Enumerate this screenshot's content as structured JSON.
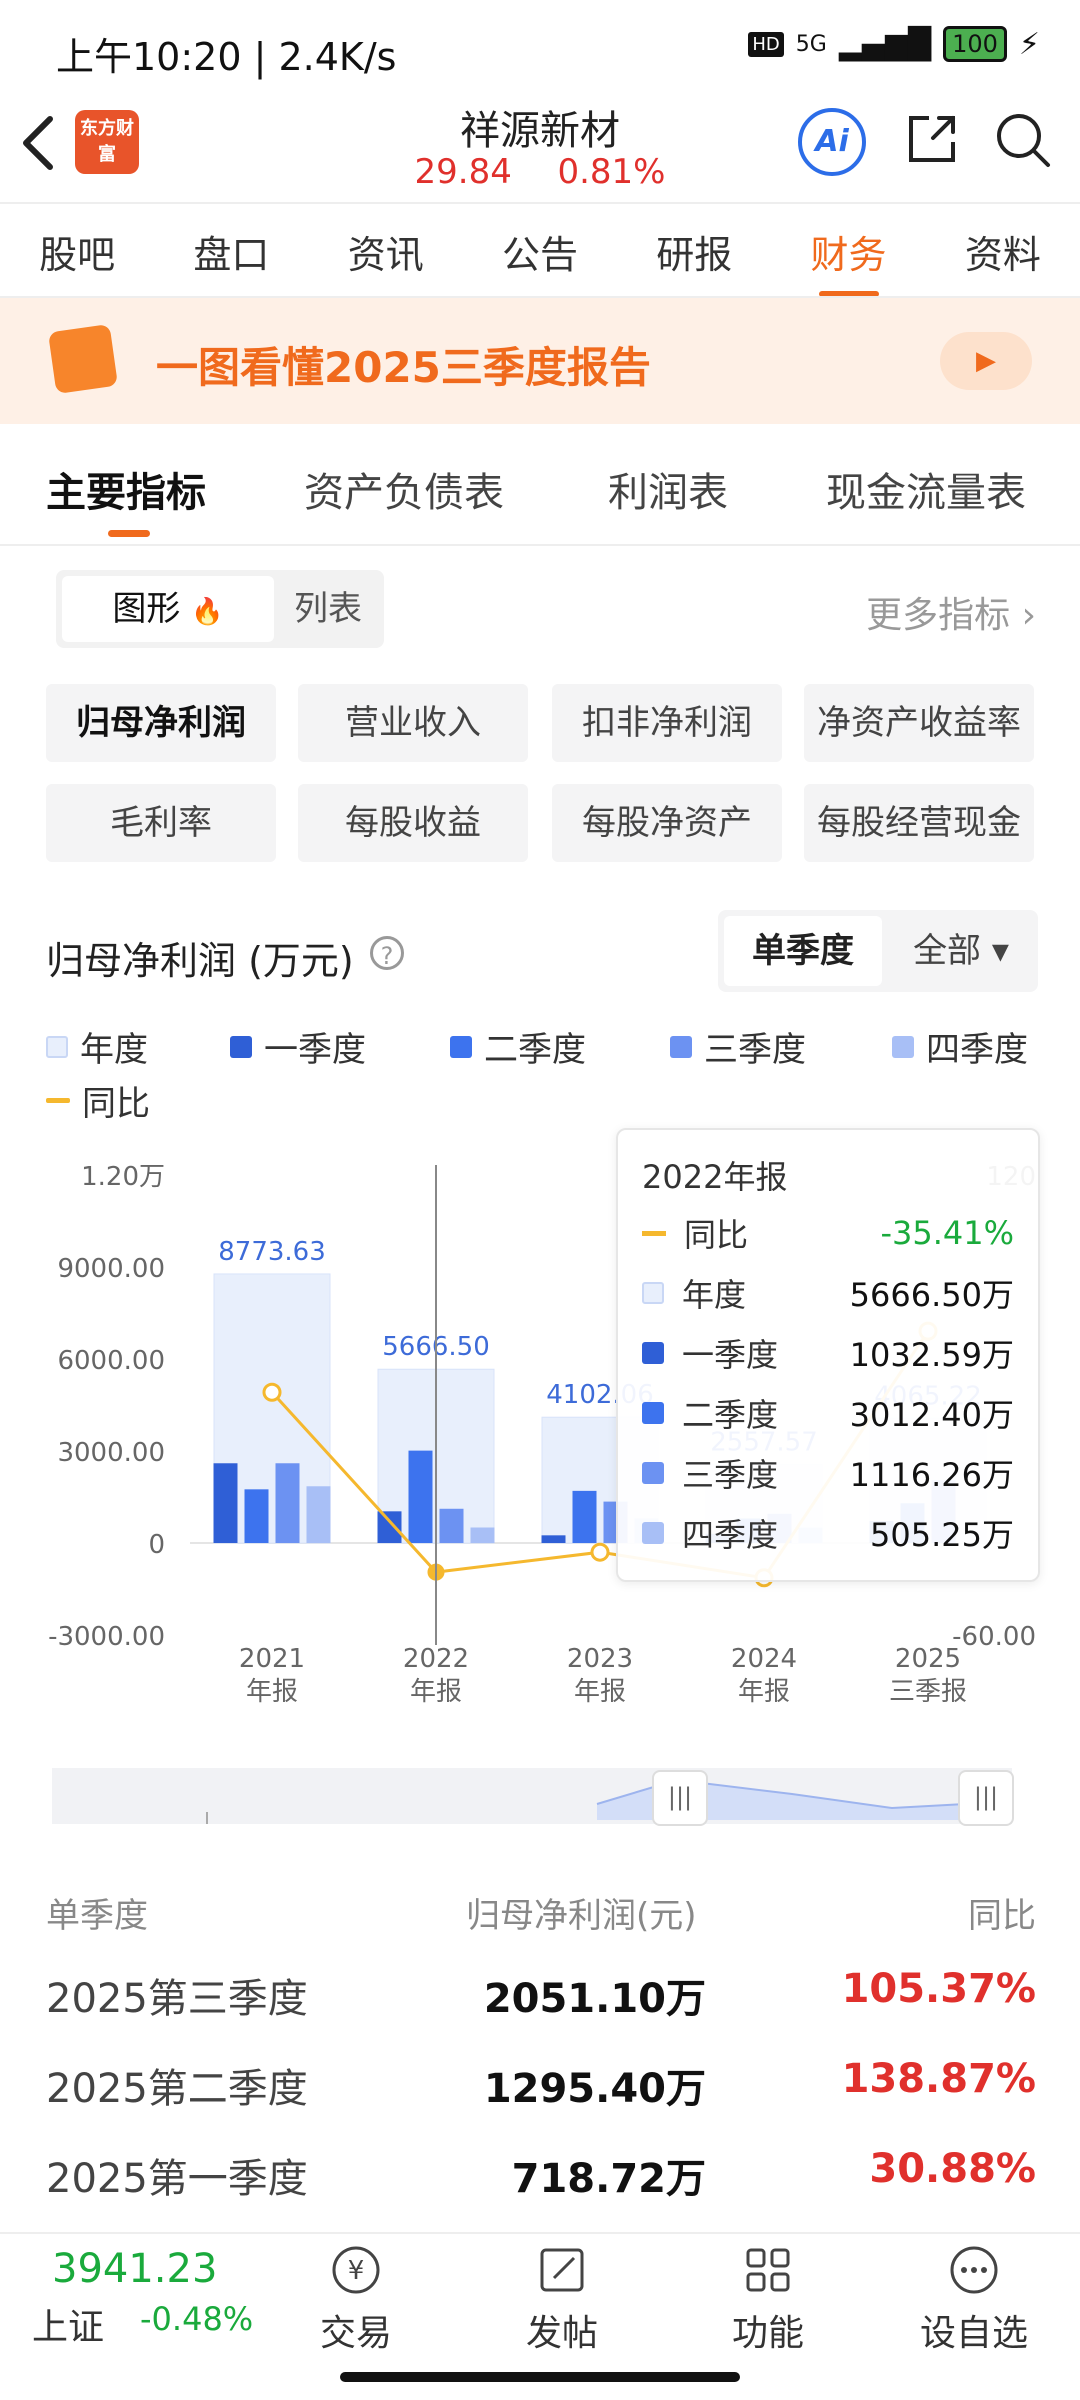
{
  "status": {
    "time": "上午10:20 | 2.4K/s",
    "network": "5G",
    "battery": "100"
  },
  "header": {
    "logo_text": "东方财富",
    "stock_name": "祥源新材",
    "price": "29.84",
    "change": "0.81%",
    "ai_label": "Ai"
  },
  "tabs": [
    "股吧",
    "盘口",
    "资讯",
    "公告",
    "研报",
    "财务",
    "资料"
  ],
  "active_tab": 5,
  "banner": {
    "text": "一图看懂2025三季度报告"
  },
  "subtabs": [
    "主要指标",
    "资产负债表",
    "利润表",
    "现金流量表"
  ],
  "view_toggle": {
    "graph": "图形",
    "list": "列表",
    "fire": "🔥"
  },
  "more_metrics": "更多指标 ›",
  "chips": [
    "归母净利润",
    "营业收入",
    "扣非净利润",
    "净资产收益率",
    "毛利率",
    "每股收益",
    "每股净资产",
    "每股经营现金"
  ],
  "chart_title": "归母净利润 (万元)",
  "help": "?",
  "period": {
    "single": "单季度",
    "all": "全部 ▾"
  },
  "legend": [
    "年度",
    "一季度",
    "二季度",
    "三季度",
    "四季度",
    "同比"
  ],
  "colors": {
    "annual": "#e8effc",
    "q1": "#2f5fd6",
    "q2": "#3d73ee",
    "q3": "#6c92f2",
    "q4": "#a8bff6",
    "yoy": "#f5b82e",
    "accent": "#f06a1d",
    "up": "#e0302c",
    "down": "#1aaa3c"
  },
  "chart_data": {
    "type": "bar",
    "categories": [
      "2021年报",
      "2022年报",
      "2023年报",
      "2024年报",
      "2025三季报"
    ],
    "x_tick_labels": [
      [
        "2021",
        "年报"
      ],
      [
        "2022",
        "年报"
      ],
      [
        "2023",
        "年报"
      ],
      [
        "2024",
        "年报"
      ],
      [
        "2025",
        "三季报"
      ]
    ],
    "y_ticks": [
      "1.20万",
      "9000.00",
      "6000.00",
      "3000.00",
      "0",
      "-3000.00"
    ],
    "y2_ticks": [
      "120",
      "-60.00"
    ],
    "ylim": [
      -3000,
      12000
    ],
    "y2lim": [
      -60,
      120
    ],
    "series": [
      {
        "name": "年度",
        "values": [
          8773.63,
          5666.5,
          4102.06,
          2557.57,
          4065.22
        ]
      },
      {
        "name": "一季度",
        "values": [
          2600,
          1032.59,
          250,
          300,
          718.72
        ]
      },
      {
        "name": "二季度",
        "values": [
          1750,
          3012.4,
          1700,
          800,
          1295.4
        ]
      },
      {
        "name": "三季度",
        "values": [
          2600,
          1116.26,
          1350,
          950,
          2051.1
        ]
      },
      {
        "name": "四季度",
        "values": [
          1850,
          505.25,
          800,
          500,
          null
        ]
      },
      {
        "name": "同比",
        "values": [
          35,
          -35.41,
          -27.6,
          -37.6,
          58.9
        ]
      }
    ],
    "data_labels": [
      "8773.63",
      "5666.50",
      "4102.06",
      "2557.57",
      "4065.22"
    ],
    "grid": false
  },
  "tooltip": {
    "title": "2022年报",
    "rows": [
      {
        "label": "同比",
        "value": "-35.41%"
      },
      {
        "label": "年度",
        "value": "5666.50万"
      },
      {
        "label": "一季度",
        "value": "1032.59万"
      },
      {
        "label": "二季度",
        "value": "3012.40万"
      },
      {
        "label": "三季度",
        "value": "1116.26万"
      },
      {
        "label": "四季度",
        "value": "505.25万"
      }
    ]
  },
  "table": {
    "headers": [
      "单季度",
      "归母净利润(元)",
      "同比"
    ],
    "rows": [
      {
        "period": "2025第三季度",
        "value": "2051.10万",
        "yoy": "105.37%"
      },
      {
        "period": "2025第二季度",
        "value": "1295.40万",
        "yoy": "138.87%"
      },
      {
        "period": "2025第一季度",
        "value": "718.72万",
        "yoy": "30.88%"
      }
    ]
  },
  "bottom": {
    "index_value": "3941.23",
    "index_name": "上证",
    "index_change": "-0.48%",
    "nav": [
      "交易",
      "发帖",
      "功能",
      "设自选"
    ]
  }
}
